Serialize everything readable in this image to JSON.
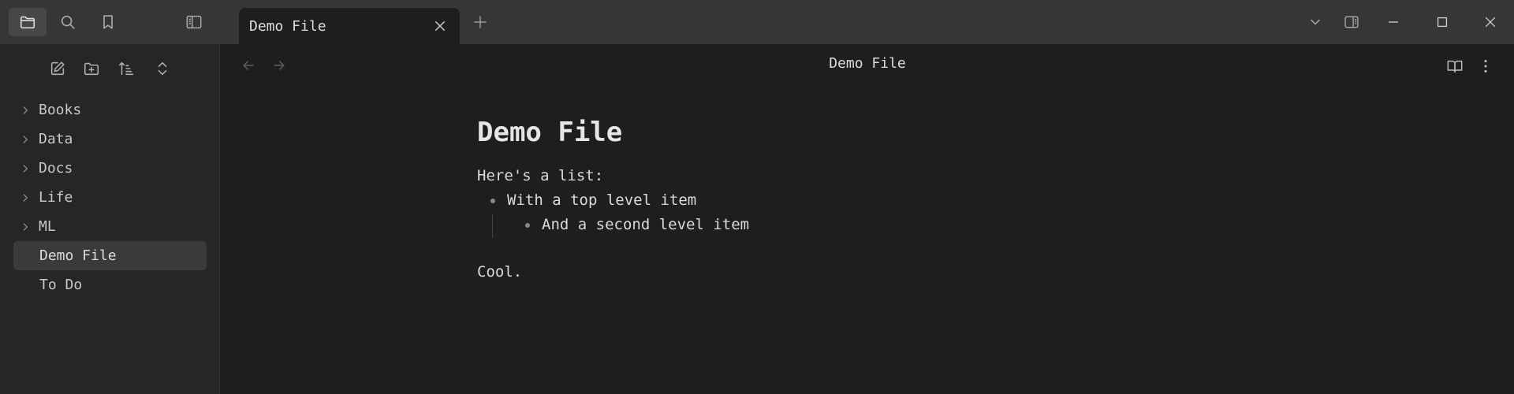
{
  "ribbon": {
    "files_icon": "folder-icon",
    "search_icon": "search-icon",
    "bookmarks_icon": "bookmark-icon",
    "sidebar_toggle_icon": "sidebar-toggle-icon"
  },
  "tab": {
    "title": "Demo File",
    "close_icon": "close-icon",
    "new_tab_icon": "plus-icon"
  },
  "window_controls": {
    "tab_list_icon": "chevron-down-icon",
    "right_sidebar_icon": "right-sidebar-icon",
    "minimize_icon": "minimize-icon",
    "maximize_icon": "maximize-icon",
    "close_icon": "close-icon"
  },
  "sidebar": {
    "toolbar": [
      "new-note-icon",
      "new-folder-icon",
      "sort-icon",
      "expand-collapse-icon"
    ],
    "items": [
      {
        "label": "Books",
        "type": "folder"
      },
      {
        "label": "Data",
        "type": "folder"
      },
      {
        "label": "Docs",
        "type": "folder"
      },
      {
        "label": "Life",
        "type": "folder"
      },
      {
        "label": "ML",
        "type": "folder"
      },
      {
        "label": "Demo File",
        "type": "file",
        "selected": true
      },
      {
        "label": "To Do",
        "type": "file"
      }
    ]
  },
  "view_header": {
    "title": "Demo File",
    "back_icon": "arrow-left-icon",
    "forward_icon": "arrow-right-icon",
    "reading_icon": "book-open-icon",
    "more_icon": "more-vertical-icon"
  },
  "document": {
    "title": "Demo File",
    "intro": "Here's a list:",
    "list_item_1": "With a top level item",
    "list_item_2": "And a second level item",
    "outro": "Cool."
  },
  "colors": {
    "topbar": "#363636",
    "sidebar": "#262626",
    "editor": "#1e1e1e",
    "selected": "#3a3a3a",
    "text": "#dadada"
  }
}
